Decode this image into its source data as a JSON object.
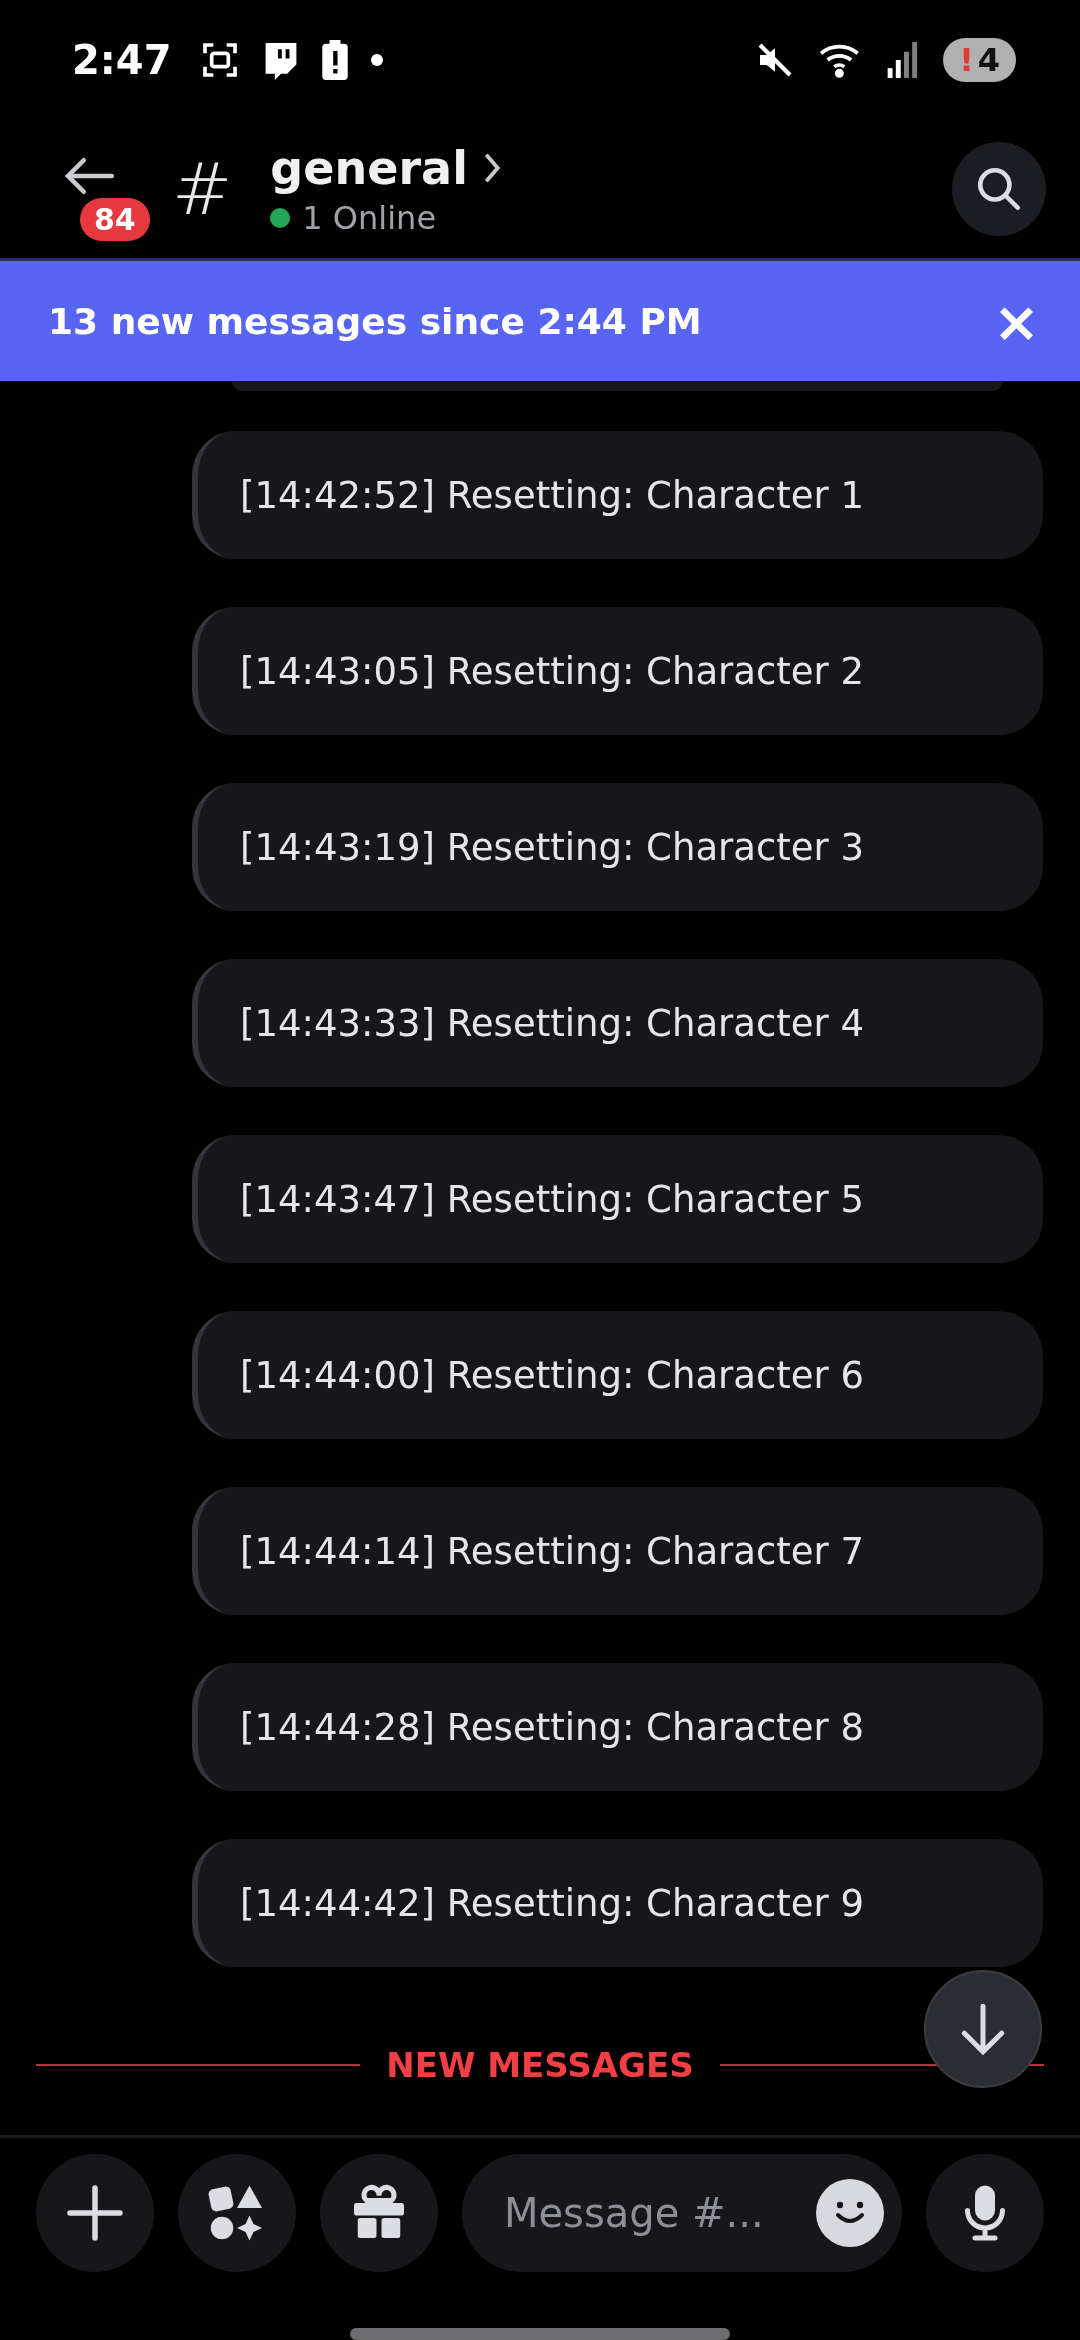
{
  "status_bar": {
    "time": "2:47",
    "battery_alert": "!",
    "battery_level_text": "4"
  },
  "header": {
    "unread_count": "84",
    "channel_symbol": "#",
    "channel_name": "general",
    "online_text": "1 Online"
  },
  "banner": {
    "text": "13 new messages since 2:44 PM",
    "close": "×"
  },
  "messages": [
    {
      "text": "[14:42:52] Resetting: Character 1"
    },
    {
      "text": "[14:43:05] Resetting: Character 2"
    },
    {
      "text": "[14:43:19] Resetting: Character 3"
    },
    {
      "text": "[14:43:33] Resetting: Character 4"
    },
    {
      "text": "[14:43:47] Resetting: Character 5"
    },
    {
      "text": "[14:44:00] Resetting: Character 6"
    },
    {
      "text": "[14:44:14] Resetting: Character 7"
    },
    {
      "text": "[14:44:28] Resetting: Character 8"
    },
    {
      "text": "[14:44:42] Resetting: Character 9"
    }
  ],
  "divider": {
    "label": "NEW MESSAGES"
  },
  "composer": {
    "placeholder": "Message #..."
  }
}
